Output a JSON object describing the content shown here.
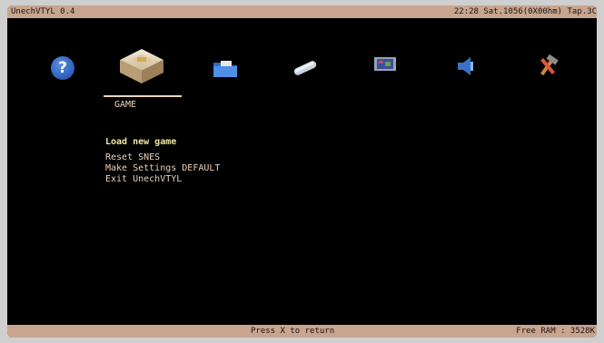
{
  "topbar": {
    "title": "UnechVTYL 0.4",
    "status": "22:28 Sat.1056(0X00hm) Tap.3C"
  },
  "icons": [
    {
      "name": "help-icon",
      "color": "#2a5fc4"
    },
    {
      "name": "game-icon",
      "color": "#e8d9b5"
    },
    {
      "name": "folder-icon",
      "color": "#3f7dd6"
    },
    {
      "name": "tube-icon",
      "color": "#b9c8d6"
    },
    {
      "name": "monitor-icon",
      "color": "#5b6fbf"
    },
    {
      "name": "speaker-icon",
      "color": "#3d74c9"
    },
    {
      "name": "tools-icon",
      "color": "#d8a050"
    }
  ],
  "active_tab": {
    "label": "GAME"
  },
  "menu": {
    "items": [
      {
        "label": "Load new game",
        "selected": true
      },
      {
        "label": "Reset SNES",
        "selected": false
      },
      {
        "label": "Make Settings DEFAULT",
        "selected": false
      },
      {
        "label": "Exit UnechVTYL",
        "selected": false
      }
    ]
  },
  "bottombar": {
    "hint": "Press X to return",
    "ram": "Free RAM : 3528K"
  }
}
